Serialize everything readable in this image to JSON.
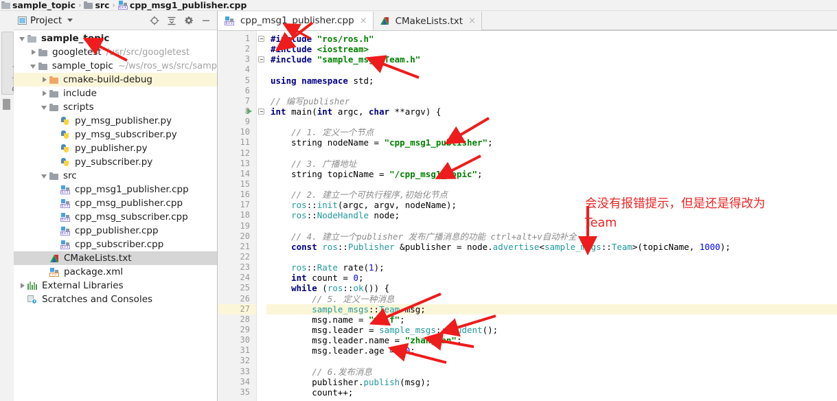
{
  "breadcrumb": {
    "items": [
      {
        "label": "sample_topic",
        "icon": "folder-icon",
        "bold": true
      },
      {
        "label": "src",
        "icon": "folder-icon",
        "bold": true
      },
      {
        "label": "cpp_msg1_publisher.cpp",
        "icon": "cpp-file-icon",
        "bold": true
      }
    ],
    "separator": "›"
  },
  "left_stripe": {
    "project_tab_label": "Project"
  },
  "project_panel": {
    "title": "Project",
    "tools": [
      {
        "name": "locate-icon",
        "title": "Select Opened File"
      },
      {
        "name": "collapse-all-icon",
        "title": "Collapse All"
      },
      {
        "name": "gear-icon",
        "title": "Settings"
      },
      {
        "name": "minimize-icon",
        "title": "Hide"
      }
    ],
    "tree": [
      {
        "label": "sample_topic",
        "sub": "",
        "icon": "folder-open-icon",
        "indent": 0,
        "arrow": "down",
        "bold": true,
        "state": "normal"
      },
      {
        "label": "googletest",
        "sub": "/usr/src/googletest",
        "icon": "folder-icon",
        "indent": 1,
        "arrow": "right",
        "bold": false,
        "state": "normal"
      },
      {
        "label": "sample_topic",
        "sub": "~/ws/ros_ws/src/samp",
        "icon": "folder-icon",
        "indent": 1,
        "arrow": "down",
        "bold": false,
        "state": "normal"
      },
      {
        "label": "cmake-build-debug",
        "sub": "",
        "icon": "folder-orange-icon",
        "indent": 2,
        "arrow": "right",
        "bold": false,
        "state": "highlight"
      },
      {
        "label": "include",
        "sub": "",
        "icon": "folder-icon",
        "indent": 2,
        "arrow": "right",
        "bold": false,
        "state": "normal"
      },
      {
        "label": "scripts",
        "sub": "",
        "icon": "folder-icon",
        "indent": 2,
        "arrow": "down",
        "bold": false,
        "state": "normal"
      },
      {
        "label": "py_msg_publisher.py",
        "sub": "",
        "icon": "python-file-icon",
        "indent": 3,
        "arrow": "none",
        "bold": false,
        "state": "normal"
      },
      {
        "label": "py_msg_subscriber.py",
        "sub": "",
        "icon": "python-file-icon",
        "indent": 3,
        "arrow": "none",
        "bold": false,
        "state": "normal"
      },
      {
        "label": "py_publisher.py",
        "sub": "",
        "icon": "python-file-icon",
        "indent": 3,
        "arrow": "none",
        "bold": false,
        "state": "normal"
      },
      {
        "label": "py_subscriber.py",
        "sub": "",
        "icon": "python-file-icon",
        "indent": 3,
        "arrow": "none",
        "bold": false,
        "state": "normal"
      },
      {
        "label": "src",
        "sub": "",
        "icon": "folder-icon",
        "indent": 2,
        "arrow": "down",
        "bold": false,
        "state": "normal"
      },
      {
        "label": "cpp_msg1_publisher.cpp",
        "sub": "",
        "icon": "cpp-file-icon",
        "indent": 3,
        "arrow": "none",
        "bold": false,
        "state": "normal"
      },
      {
        "label": "cpp_msg_publisher.cpp",
        "sub": "",
        "icon": "cpp-file-icon",
        "indent": 3,
        "arrow": "none",
        "bold": false,
        "state": "normal"
      },
      {
        "label": "cpp_msg_subscriber.cpp",
        "sub": "",
        "icon": "cpp-file-icon",
        "indent": 3,
        "arrow": "none",
        "bold": false,
        "state": "normal"
      },
      {
        "label": "cpp_publisher.cpp",
        "sub": "",
        "icon": "cpp-file-icon",
        "indent": 3,
        "arrow": "none",
        "bold": false,
        "state": "normal"
      },
      {
        "label": "cpp_subscriber.cpp",
        "sub": "",
        "icon": "cpp-file-icon",
        "indent": 3,
        "arrow": "none",
        "bold": false,
        "state": "normal"
      },
      {
        "label": "CMakeLists.txt",
        "sub": "",
        "icon": "cmake-file-icon",
        "indent": 2,
        "arrow": "none",
        "bold": false,
        "state": "selected"
      },
      {
        "label": "package.xml",
        "sub": "",
        "icon": "xml-file-icon",
        "indent": 2,
        "arrow": "none",
        "bold": false,
        "state": "normal"
      },
      {
        "label": "External Libraries",
        "sub": "",
        "icon": "libraries-icon",
        "indent": 0,
        "arrow": "right",
        "bold": false,
        "state": "normal"
      },
      {
        "label": "Scratches and Consoles",
        "sub": "",
        "icon": "scratches-icon",
        "indent": 0,
        "arrow": "none",
        "bold": false,
        "state": "normal"
      }
    ]
  },
  "editor": {
    "tabs": [
      {
        "label": "cpp_msg1_publisher.cpp",
        "icon": "cpp-file-icon",
        "active": true,
        "close": "×"
      },
      {
        "label": "CMakeLists.txt",
        "icon": "cmake-file-icon",
        "active": false,
        "close": "×"
      }
    ],
    "highlight_line": 27,
    "run_marker_line": 8,
    "lines": [
      {
        "n": 1,
        "text": "#include \"ros/ros.h\""
      },
      {
        "n": 2,
        "text": "#include <iostream>"
      },
      {
        "n": 3,
        "text": "#include \"sample_msgs/Team.h\""
      },
      {
        "n": 4,
        "text": ""
      },
      {
        "n": 5,
        "text": "using namespace std;"
      },
      {
        "n": 6,
        "text": ""
      },
      {
        "n": 7,
        "text": "// 编写publisher"
      },
      {
        "n": 8,
        "text": "int main(int argc, char **argv) {"
      },
      {
        "n": 9,
        "text": ""
      },
      {
        "n": 10,
        "text": "    // 1. 定义一个节点"
      },
      {
        "n": 11,
        "text": "    string nodeName = \"cpp_msg1_publisher\";"
      },
      {
        "n": 12,
        "text": ""
      },
      {
        "n": 13,
        "text": "    // 3. 广播地址"
      },
      {
        "n": 14,
        "text": "    string topicName = \"/cpp_msg1_topic\";"
      },
      {
        "n": 15,
        "text": ""
      },
      {
        "n": 16,
        "text": "    // 2. 建立一个可执行程序,初始化节点"
      },
      {
        "n": 17,
        "text": "    ros::init(argc, argv, nodeName);"
      },
      {
        "n": 18,
        "text": "    ros::NodeHandle node;"
      },
      {
        "n": 19,
        "text": ""
      },
      {
        "n": 20,
        "text": "    // 4. 建立一个publisher 发布广播消息的功能 ctrl+alt+v自动补全"
      },
      {
        "n": 21,
        "text": "    const ros::Publisher &publisher = node.advertise<sample_msgs::Team>(topicName, 1000);"
      },
      {
        "n": 22,
        "text": ""
      },
      {
        "n": 23,
        "text": "    ros::Rate rate(1);"
      },
      {
        "n": 24,
        "text": "    int count = 0;"
      },
      {
        "n": 25,
        "text": "    while (ros::ok()) {"
      },
      {
        "n": 26,
        "text": "        // 5. 定义一种消息"
      },
      {
        "n": 27,
        "text": "        sample_msgs::Team msg;"
      },
      {
        "n": 28,
        "text": "        msg.name = \"wolf\";"
      },
      {
        "n": 29,
        "text": "        msg.leader = sample_msgs::Student();"
      },
      {
        "n": 30,
        "text": "        msg.leader.name = \"zhangsan\";"
      },
      {
        "n": 31,
        "text": "        msg.leader.age = 20;"
      },
      {
        "n": 32,
        "text": ""
      },
      {
        "n": 33,
        "text": "        // 6.发布消息"
      },
      {
        "n": 34,
        "text": "        publisher.publish(msg);"
      },
      {
        "n": 35,
        "text": "        count++;"
      }
    ]
  },
  "annotations": {
    "color": "#ee2222",
    "note_line1": "会没有报错提示，但是还是得改为",
    "note_line2": "Team",
    "arrow_count": 9
  }
}
